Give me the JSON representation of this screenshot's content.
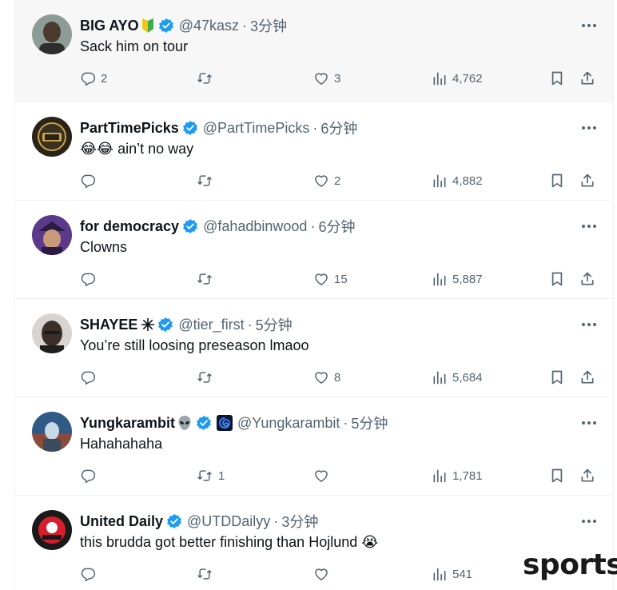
{
  "tweets": [
    {
      "name": "BIG AYO",
      "name_emoji": "beginner-badge-emoji",
      "verified": true,
      "handle": "@47kasz",
      "separator": "·",
      "time": "3分钟",
      "text": "Sack him on tour",
      "replies": "2",
      "retweets": "",
      "likes": "3",
      "views": "4,762",
      "avatar_color": "#7b8a86"
    },
    {
      "name": "PartTimePicks",
      "verified": true,
      "handle": "@PartTimePicks",
      "separator": "·",
      "time": "6分钟",
      "text_emoji": "😂😂",
      "text": "ain’t no way",
      "replies": "",
      "retweets": "",
      "likes": "2",
      "views": "4,882",
      "avatar_color": "#2a2418"
    },
    {
      "name": "for democracy",
      "verified": true,
      "handle": "@fahadbinwood",
      "separator": "·",
      "time": "6分钟",
      "text": "Clowns",
      "replies": "",
      "retweets": "",
      "likes": "15",
      "views": "5,887",
      "avatar_color": "#5b3a8c"
    },
    {
      "name": "SHAYEE",
      "name_emoji": "spark-emoji",
      "verified": true,
      "handle": "@tier_first",
      "separator": "·",
      "time": "5分钟",
      "text": "You’re still loosing preseason lmaoo",
      "replies": "",
      "retweets": "",
      "likes": "8",
      "views": "5,684",
      "avatar_color": "#3a2e28"
    },
    {
      "name": "Yungkarambit",
      "name_emoji": "alien-emoji",
      "verified": true,
      "extra_badge": "swirl-badge-icon",
      "handle": "@Yungkarambit",
      "separator": "·",
      "time": "5分钟",
      "text": "Hahahahaha",
      "replies": "",
      "retweets": "1",
      "likes": "",
      "views": "1,781",
      "avatar_color": "#2f5b86"
    },
    {
      "name": "United Daily",
      "verified": true,
      "handle": "@UTDDailyy",
      "separator": "·",
      "time": "3分钟",
      "text": "this brudda got better finishing than Hojlund",
      "text_emoji_after": "😭",
      "replies": "",
      "retweets": "",
      "likes": "",
      "views": "541",
      "avatar_color": "#1a1a1a"
    }
  ],
  "watermark": "sports",
  "colors": {
    "verified": "#1d9bf0",
    "secondary_text": "#536471",
    "hover_bg": "#f7f7f7"
  }
}
